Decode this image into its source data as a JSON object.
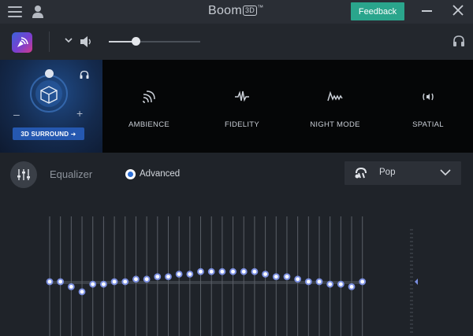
{
  "window": {
    "title": "Boom",
    "title_badge": "3D",
    "title_mark": "™",
    "feedback_label": "Feedback"
  },
  "toolbar": {
    "volume_level": 0.3
  },
  "effects": {
    "surround_button_label": "3D SURROUND ➜",
    "minus": "–",
    "plus": "+",
    "items": [
      {
        "label": "AMBIENCE",
        "icon": "ambience-icon"
      },
      {
        "label": "FIDELITY",
        "icon": "fidelity-icon"
      },
      {
        "label": "NIGHT MODE",
        "icon": "night-mode-icon"
      },
      {
        "label": "SPATIAL",
        "icon": "spatial-icon"
      }
    ]
  },
  "equalizer": {
    "title": "Equalizer",
    "advanced_label": "Advanced",
    "advanced_selected": true,
    "preset": "Pop",
    "band_levels": [
      0,
      0,
      -2,
      -4,
      -1,
      -1,
      0,
      0,
      1,
      1,
      2,
      2,
      3,
      3,
      4,
      4,
      4,
      4,
      4,
      4,
      3,
      2,
      2,
      1,
      0,
      0,
      -1,
      -1,
      -2,
      0
    ],
    "preamp_level": 0
  },
  "colors": {
    "accent": "#2aa58c",
    "eq_knob": "#7b8fe0",
    "surround_button": "#2558b0"
  }
}
